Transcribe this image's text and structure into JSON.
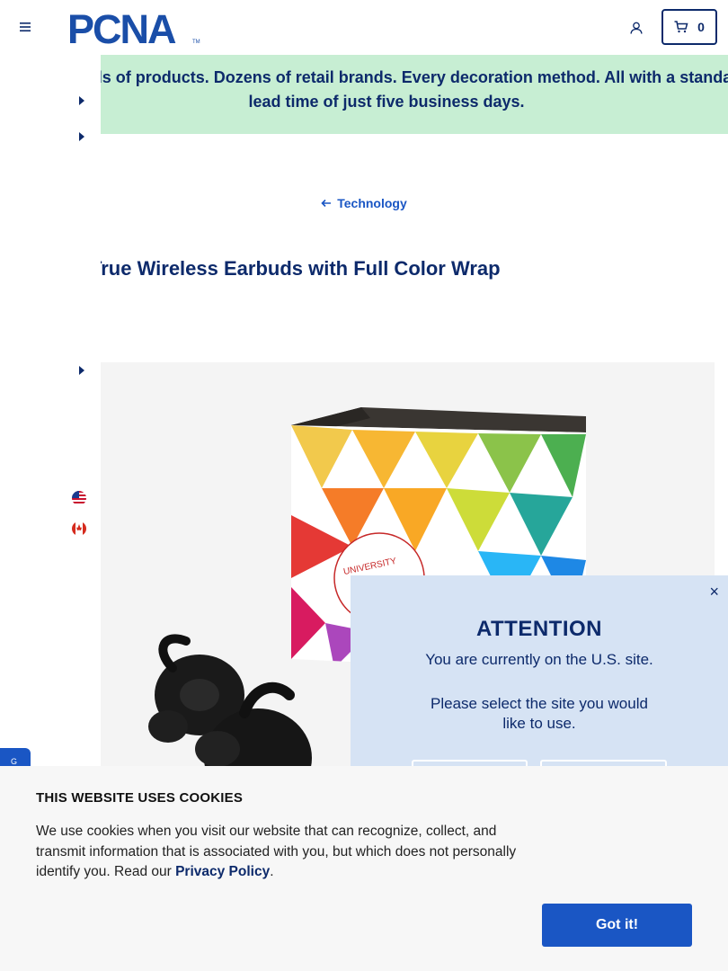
{
  "header": {
    "logo_text": "PCNA",
    "cart_count": "0"
  },
  "promo": {
    "text": "Thousands of products. Dozens of retail brands. Every decoration method. All with a standard lead time of just five business days."
  },
  "breadcrumb": {
    "label": "Technology"
  },
  "product": {
    "title": "True Wireless Earbuds with Full Color Wrap",
    "box_text": "UNIVERSITY"
  },
  "feedback_tab": {
    "label": "G"
  },
  "site_modal": {
    "close": "×",
    "heading": "ATTENTION",
    "line1": "You are currently on the U.S. site.",
    "line2": "Please select the site you would like to use."
  },
  "cookie_banner": {
    "title": "THIS WEBSITE USES COOKIES",
    "body": "We use cookies when you visit our website that can recognize, collect, and transmit information that is associated with you, but which does not personally identify you. Read our ",
    "link": "Privacy Policy",
    "end": ".",
    "button": "Got it!"
  },
  "colors": {
    "navy": "#0d2a6b",
    "link_blue": "#1a56c4",
    "promo_green": "#c7eed3",
    "modal_blue": "#d6e3f4",
    "cookie_bg": "#f7f7f7"
  }
}
